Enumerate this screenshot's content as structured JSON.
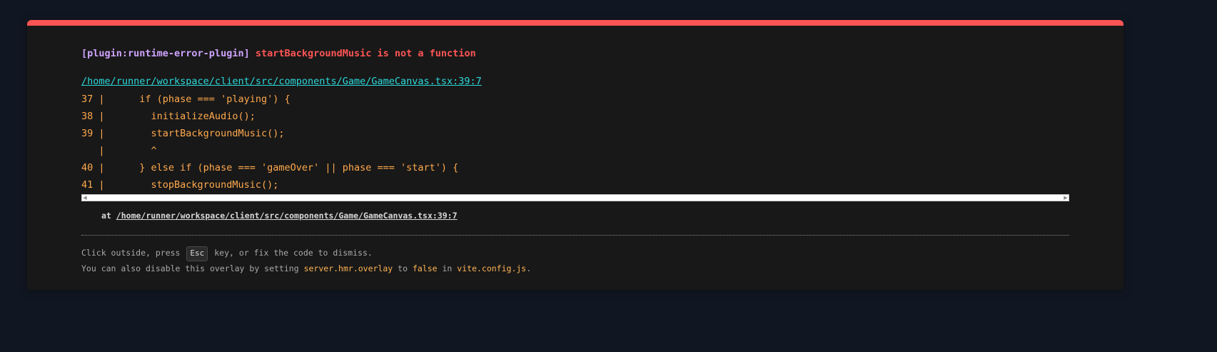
{
  "error": {
    "plugin": "[plugin:runtime-error-plugin]",
    "message": "startBackgroundMusic is not a function",
    "file": "/home/runner/workspace/client/src/components/Game/GameCanvas.tsx:39:7",
    "frame": [
      "37 |      if (phase === 'playing') {",
      "38 |        initializeAudio();",
      "39 |        startBackgroundMusic();",
      "   |        ^",
      "40 |      } else if (phase === 'gameOver' || phase === 'start') {",
      "41 |        stopBackgroundMusic();"
    ],
    "stack_prefix": "at",
    "stack_file": "/home/runner/workspace/client/src/components/Game/GameCanvas.tsx:39:7"
  },
  "tips": {
    "line1_before": "Click outside, press",
    "esc_key": "Esc",
    "line1_after": "key, or fix the code to dismiss.",
    "line2_before": "You can also disable this overlay by setting",
    "config_key": "server.hmr.overlay",
    "to": "to",
    "false_value": "false",
    "in": "in",
    "config_file": "vite.config.js",
    "period": "."
  },
  "colors": {
    "accent_red": "#ff5555",
    "plugin_purple": "#cfa4ff",
    "link_cyan": "#2dd9da",
    "code_orange": "#ffa94d",
    "highlight_yellow": "#ffb454",
    "background": "#111722",
    "panel": "#181818"
  }
}
